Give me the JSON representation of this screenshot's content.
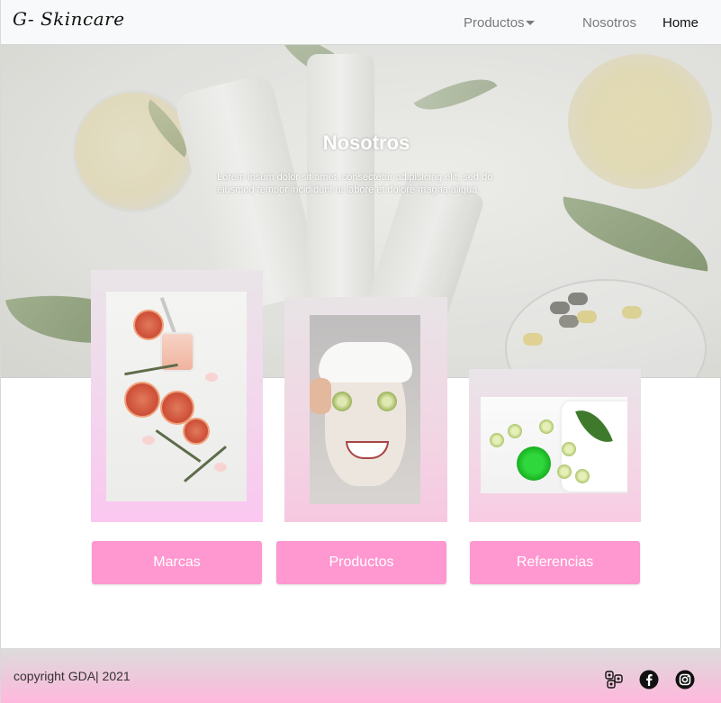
{
  "navbar": {
    "brand": "G- Skincare",
    "productos_label": "Productos",
    "nosotros_label": "Nosotros",
    "home_label": "Home"
  },
  "hero": {
    "title": "Nosotros",
    "text": "Lorem ipsum dolor sit amet, consectetur adipisicing elit, sed do eiusmod tempor incididunt ut labore et dolore magna aliqua."
  },
  "buttons": {
    "marcas": "Marcas",
    "productos": "Productos",
    "referencias": "Referencias"
  },
  "footer": {
    "copyright": "copyright GDA| 2021",
    "icons": [
      "social-network-icon",
      "facebook-icon",
      "instagram-icon"
    ]
  },
  "colors": {
    "button_pink": "#ff97d0",
    "navbar_bg": "#f8f9fa"
  }
}
